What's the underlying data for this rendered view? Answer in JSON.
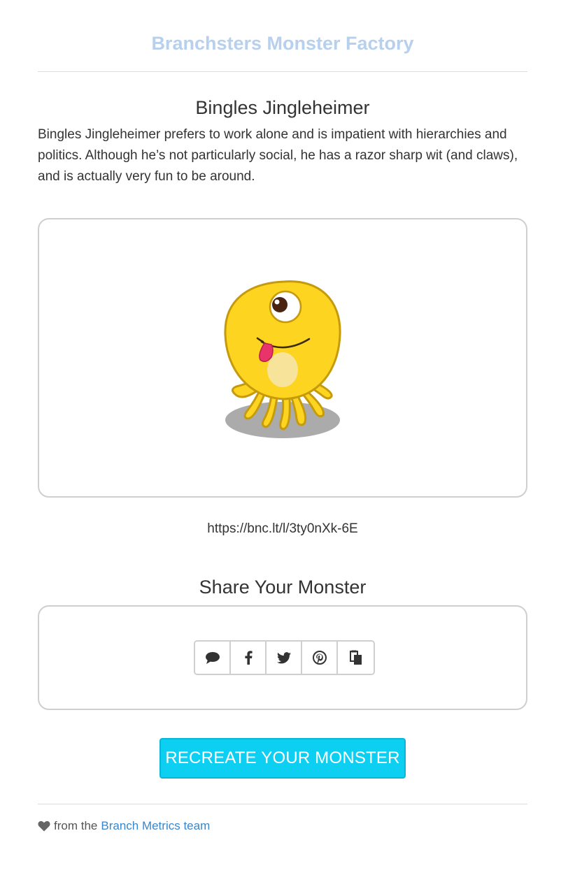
{
  "header": {
    "title": "Branchsters Monster Factory"
  },
  "monster": {
    "name": "Bingles Jingleheimer",
    "description": "Bingles Jingleheimer prefers to work alone and is impatient with hierarchies and politics. Although he’s not particularly social, he has a razor sharp wit (and claws), and is actually very fun to be around.",
    "image_icon": "yellow-one-eyed-monster",
    "colors": {
      "body": "#fdd41f",
      "outline": "#c59a0c",
      "belly": "#f7e39a",
      "tongue": "#e8336b",
      "shadow": "#ababab"
    }
  },
  "link": {
    "url": "https://bnc.lt/l/3ty0nXk-6E"
  },
  "share": {
    "heading": "Share Your Monster",
    "buttons": [
      {
        "icon": "sms-speech-bubble-icon"
      },
      {
        "icon": "facebook-icon"
      },
      {
        "icon": "twitter-icon"
      },
      {
        "icon": "pinterest-icon"
      },
      {
        "icon": "copy-clipboard-icon"
      }
    ]
  },
  "recreate_button": {
    "label": "RECREATE YOUR MONSTER",
    "color": "#0ccff2"
  },
  "footer": {
    "prefix": "from the",
    "link_text": "Branch Metrics team",
    "link_color": "#3a86c8"
  }
}
